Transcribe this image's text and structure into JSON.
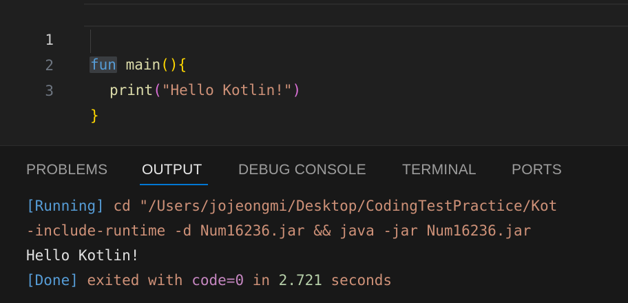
{
  "editor": {
    "lines": [
      {
        "number": "1",
        "kw": "fun",
        "space": " ",
        "fn": "main",
        "open": "(){"
      },
      {
        "number": "2",
        "fn": "print",
        "open": "(",
        "str": "\"Hello Kotlin!\"",
        "close": ")"
      },
      {
        "number": "3",
        "close": "}"
      }
    ]
  },
  "panel": {
    "tabs": [
      "PROBLEMS",
      "OUTPUT",
      "DEBUG CONSOLE",
      "TERMINAL",
      "PORTS"
    ],
    "active_tab": "OUTPUT",
    "output": {
      "line1_tag": "[Running]",
      "line1_cmd": " cd \"/Users/jojeongmi/Desktop/CodingTestPractice/Kot",
      "line2": "-include-runtime -d Num16236.jar && java -jar Num16236.jar",
      "line3": "Hello Kotlin!",
      "line4_tag": "[Done]",
      "line4_a": " exited with ",
      "line4_code": "code=0",
      "line4_b": " in ",
      "line4_time": "2.721",
      "line4_c": " seconds"
    }
  },
  "colors": {
    "editor_bg": "#1f1f1f",
    "panel_bg": "#181818",
    "accent": "#0078d4",
    "keyword": "#569cd6",
    "function": "#dcdcaa",
    "string": "#ce9178"
  }
}
